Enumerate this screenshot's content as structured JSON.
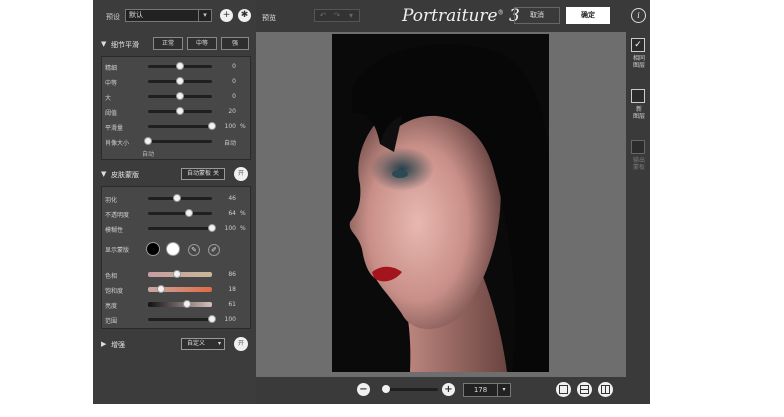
{
  "header": {
    "preset_label": "预设",
    "preset_value": "默认",
    "preview_label": "预览",
    "logo": "Portraiture",
    "logo_version": "3",
    "cancel": "取消",
    "ok": "确定"
  },
  "detail": {
    "title": "细节平滑",
    "modes": [
      "正常",
      "中等",
      "强"
    ],
    "rows": [
      {
        "label": "精细",
        "value": "0",
        "unit": "",
        "level": 0.5
      },
      {
        "label": "中等",
        "value": "0",
        "unit": "",
        "level": 0.5
      },
      {
        "label": "大",
        "value": "0",
        "unit": "",
        "level": 0.5
      },
      {
        "label": "阈值",
        "value": "20",
        "unit": "",
        "level": 0.5
      },
      {
        "label": "平滑量",
        "value": "100",
        "unit": "%",
        "level": 1.0
      },
      {
        "label": "肖像大小",
        "value": "",
        "unit": "",
        "level": 0.0
      }
    ],
    "size_min": "自动",
    "size_max": "自动"
  },
  "mask": {
    "title": "皮肤蒙版",
    "auto_btn": "自动蒙板 关",
    "toggle": "开",
    "rows": [
      {
        "label": "羽化",
        "value": "46",
        "unit": "",
        "level": 0.46
      },
      {
        "label": "不透明度",
        "value": "64",
        "unit": "%",
        "level": 0.64
      },
      {
        "label": "模糊性",
        "value": "100",
        "unit": "%",
        "level": 1.0
      }
    ],
    "show_mask_label": "显示蒙版",
    "tone_rows": [
      {
        "label": "色相",
        "value": "86",
        "level": 0.45
      },
      {
        "label": "饱和度",
        "value": "18",
        "level": 0.2
      },
      {
        "label": "亮度",
        "value": "61",
        "level": 0.61
      },
      {
        "label": "范围",
        "value": "100",
        "level": 1.0
      }
    ]
  },
  "enhance": {
    "title": "增强",
    "mode_value": "自定义",
    "toggle": "开"
  },
  "zoom": {
    "value": "178",
    "level": 0.0
  },
  "side_modes": [
    {
      "label_line1": "相同",
      "label_line2": "图层",
      "checked": true,
      "enabled": true
    },
    {
      "label_line1": "新",
      "label_line2": "图层",
      "checked": false,
      "enabled": true
    },
    {
      "label_line1": "输出",
      "label_line2": "蒙板",
      "checked": false,
      "enabled": false
    }
  ]
}
